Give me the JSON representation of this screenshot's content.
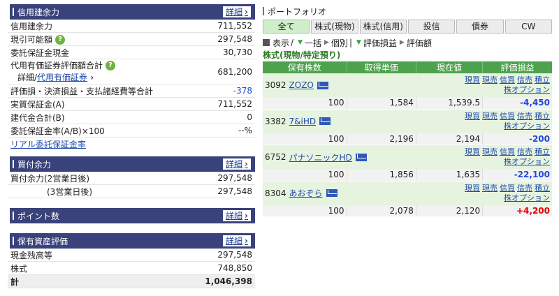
{
  "credit": {
    "title": "信用建余力",
    "detail": "詳細",
    "rows": [
      {
        "label": "信用建余力",
        "value": "711,552"
      },
      {
        "label": "現引可能額",
        "value": "297,548"
      },
      {
        "label": "委託保証金現金",
        "value": "30,730"
      },
      {
        "label": "代用有価証券評価額合計",
        "label2a": "詳細/",
        "label2b": "代用有価証券",
        "value": "681,200"
      },
      {
        "label": "評価損・決済損益・支払諸経費等合計",
        "value": "-378"
      },
      {
        "label": "実質保証金(A)",
        "value": "711,552"
      },
      {
        "label": "建代金合計(B)",
        "value": "0"
      },
      {
        "label": "委託保証金率(A/B)×100",
        "value": "--%"
      }
    ],
    "link": "リアル委託保証金率"
  },
  "buying": {
    "title": "買付余力",
    "detail": "詳細",
    "rows": [
      {
        "label": "買付余力(2営業日後)",
        "value": "297,548"
      },
      {
        "label": "(3営業日後)",
        "value": "297,548"
      }
    ]
  },
  "points": {
    "title": "ポイント数",
    "detail": "詳細"
  },
  "assets": {
    "title": "保有資産評価",
    "detail": "詳細",
    "rows": [
      {
        "label": "現金残高等",
        "value": "297,548"
      },
      {
        "label": "株式",
        "value": "748,850"
      }
    ],
    "total_label": "計",
    "total_value": "1,046,398"
  },
  "portfolio": {
    "title": "ポートフォリオ",
    "tabs": [
      "全て",
      "株式(現物)",
      "株式(信用)",
      "投信",
      "債券",
      "CW"
    ],
    "view": {
      "label": "表示",
      "sep": "/",
      "bulk": "一括",
      "individual": "個別",
      "pl": "評価損益",
      "valuation": "評価額"
    },
    "section": "株式(現物/特定預り)",
    "headers": [
      "保有株数",
      "取得単価",
      "現在値",
      "評価損益"
    ],
    "actions": [
      "現買",
      "現売",
      "信買",
      "信売",
      "積立"
    ],
    "option_link": "株オプション",
    "holdings": [
      {
        "code": "3092",
        "name": "ZOZO",
        "shares": "100",
        "cost": "1,584",
        "price": "1,539.5",
        "pl": "-4,450",
        "sign": "neg"
      },
      {
        "code": "3382",
        "name": "7&iHD",
        "shares": "100",
        "cost": "2,196",
        "price": "2,194",
        "pl": "-200",
        "sign": "neg"
      },
      {
        "code": "6752",
        "name": "パナソニックHD",
        "shares": "100",
        "cost": "1,856",
        "price": "1,635",
        "pl": "-22,100",
        "sign": "neg"
      },
      {
        "code": "8304",
        "name": "あおぞら",
        "shares": "100",
        "cost": "2,078",
        "price": "2,120",
        "pl": "+4,200",
        "sign": "pos"
      }
    ]
  }
}
